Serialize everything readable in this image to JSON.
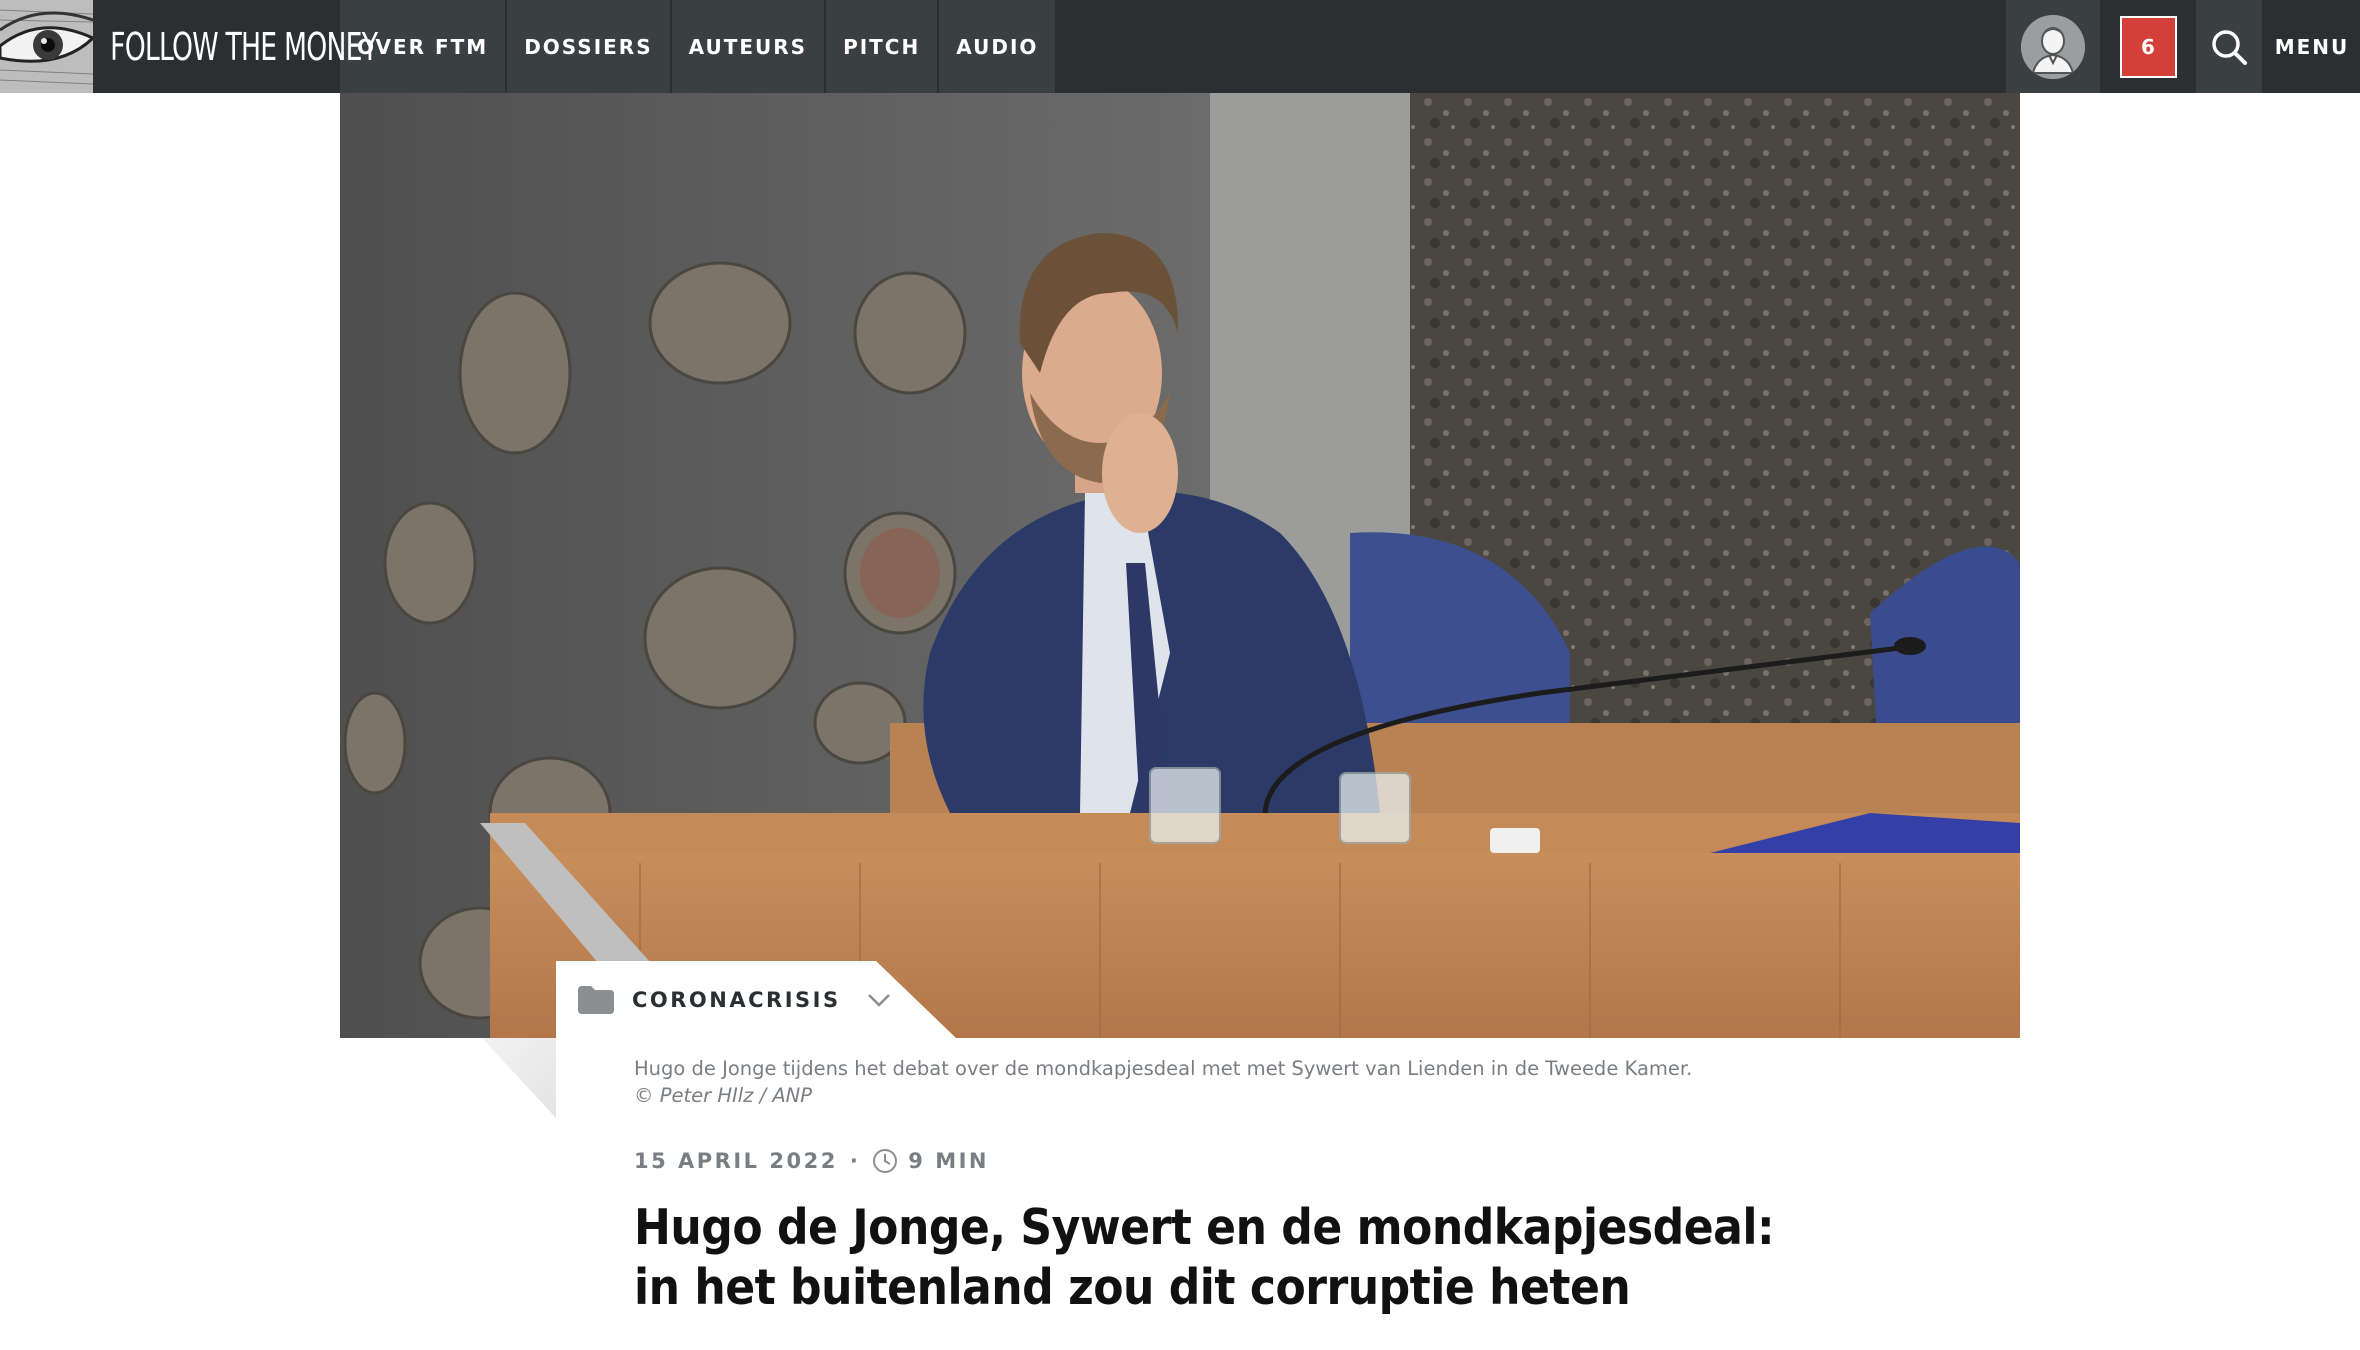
{
  "header": {
    "brand": "FOLLOW THE MONEY",
    "nav": [
      {
        "label": "OVER FTM"
      },
      {
        "label": "DOSSIERS"
      },
      {
        "label": "AUTEURS"
      },
      {
        "label": "PITCH"
      },
      {
        "label": "AUDIO"
      }
    ],
    "notification_count": "6",
    "menu_label": "MENU",
    "icons": {
      "logo": "eye-logo-icon",
      "avatar": "user-avatar-icon",
      "search": "search-icon"
    }
  },
  "article": {
    "category": "CORONACRISIS",
    "caption_text": "Hugo de Jonge tijdens het debat over de mondkapjesdeal met met Sywert van Lienden in de Tweede Kamer.",
    "caption_credit": "© Peter HIlz / ANP",
    "date": "15 APRIL 2022",
    "reading_time": "9 MIN",
    "title": "Hugo de Jonge, Sywert en de mondkapjesdeal: in het buitenland zou dit corruptie heten"
  },
  "colors": {
    "nav_bg": "#2b2f31",
    "nav_item_bg": "#3a3f42",
    "badge": "#d3403a",
    "meta_text": "#7a7e82"
  }
}
